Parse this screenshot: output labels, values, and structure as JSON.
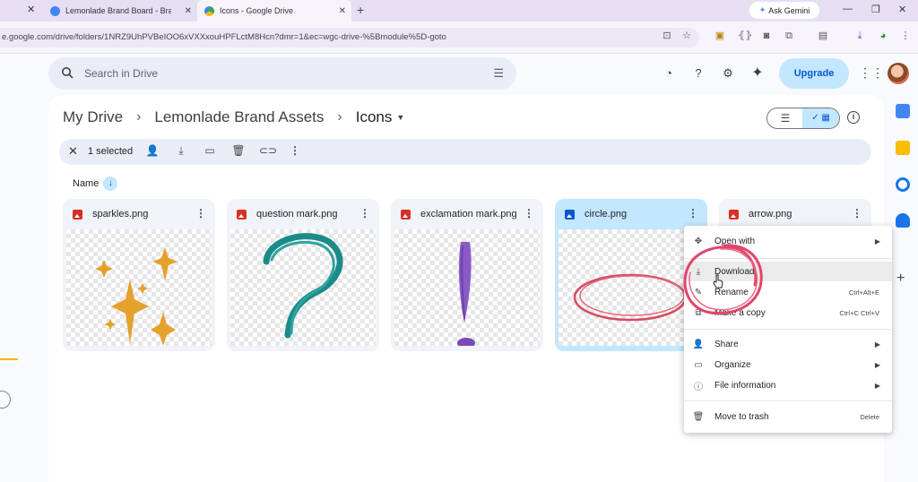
{
  "browser": {
    "tabs": [
      {
        "title": "Lemonlade Brand Board - Brand",
        "favicon_color": "#4285f4"
      },
      {
        "title": "Icons - Google Drive",
        "favicon_color": "#34a853"
      }
    ],
    "ask_gemini": "Ask Gemini",
    "url": "e.google.com/drive/folders/1NRZ9UhPVBeIOO6xVXXxouHPFLctM8Hcn?dmr=1&ec=wgc-drive-%5Bmodule%5D-goto"
  },
  "drive": {
    "search_placeholder": "Search in Drive",
    "upgrade_label": "Upgrade",
    "breadcrumb": [
      "My Drive",
      "Lemonlade Brand Assets",
      "Icons"
    ],
    "selection": {
      "count_text": "1 selected"
    },
    "sort": {
      "label": "Name"
    },
    "files": [
      {
        "name": "sparkles.png",
        "selected": false
      },
      {
        "name": "question mark.png",
        "selected": false
      },
      {
        "name": "exclamation mark.png",
        "selected": false
      },
      {
        "name": "circle.png",
        "selected": true
      },
      {
        "name": "arrow.png",
        "selected": false
      }
    ]
  },
  "context_menu": {
    "items": [
      {
        "label": "Open with",
        "icon": "move-icon",
        "submenu": true
      },
      {
        "label": "Download",
        "icon": "download-icon",
        "highlighted": true
      },
      {
        "label": "Rename",
        "icon": "pencil-icon",
        "shortcut": "Ctrl+Alt+E"
      },
      {
        "label": "Make a copy",
        "icon": "copy-icon",
        "shortcut": "Ctrl+C Ctrl+V"
      },
      {
        "label": "Share",
        "icon": "share-icon",
        "submenu": true
      },
      {
        "label": "Organize",
        "icon": "folder-icon",
        "submenu": true
      },
      {
        "label": "File information",
        "icon": "info-icon",
        "submenu": true
      },
      {
        "label": "Move to trash",
        "icon": "trash-icon",
        "shortcut": "Delete"
      }
    ]
  },
  "colors": {
    "accent": "#0b57d0",
    "selected_card": "#c2e7ff",
    "annotation_ring": "#e0476a"
  }
}
